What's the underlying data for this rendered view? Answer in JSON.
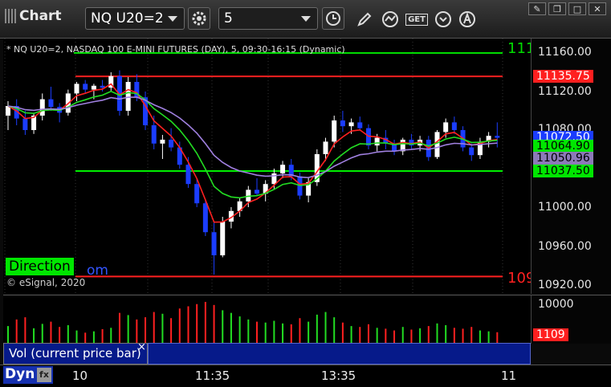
{
  "toolbar": {
    "title": "Chart",
    "symbol": "NQ U20=2",
    "interval": "5",
    "get_label": "GET"
  },
  "chart": {
    "description": "* NQ U20=2, NASDAQ 100 E-MINI FUTURES (DAY), 5, 09:30-16:15 (Dynamic)",
    "copyright": "© eSignal, 2020",
    "direction_label": "Direction",
    "partial_label": "om",
    "green_line_label": "111",
    "red_line_label": "109",
    "y_ticks": [
      "11160.00",
      "11120.00",
      "11080.00",
      "11000.00",
      "10960.00",
      "10920.00"
    ],
    "price_tags": [
      {
        "text": "11135.75",
        "bg": "#ff1f1f",
        "fg": "#ffffff",
        "price": 11135.75
      },
      {
        "text": "11072.50",
        "bg": "#1a3cff",
        "fg": "#ffffff",
        "price": 11072.5
      },
      {
        "text": "11064.90",
        "bg": "#00e600",
        "fg": "#000000",
        "price": 11064.9
      },
      {
        "text": "11050.96",
        "bg": "#8c7ab8",
        "fg": "#000000",
        "price": 11050.96
      },
      {
        "text": "11037.50",
        "bg": "#00e600",
        "fg": "#000000",
        "price": 11037.5
      }
    ],
    "levels": [
      {
        "price": 11160,
        "color": "#00dd00"
      },
      {
        "price": 11135.75,
        "color": "#ff2020"
      },
      {
        "price": 11037.5,
        "color": "#ff2020"
      },
      {
        "price": 11037.5,
        "color": "#00ee00"
      },
      {
        "price": 10928,
        "color": "#ff2020"
      }
    ],
    "colors": {
      "up": "#ffffff",
      "down": "#1b3dff",
      "ema_fast": "#ff2020",
      "ema_mid": "#22dd22",
      "ema_slow": "#a080e0"
    }
  },
  "volume": {
    "y_tick": "10000",
    "tag": "1109",
    "tag_bg": "#ff1f1f",
    "panel_label": "Vol (current price bar)",
    "close_glyph": "×"
  },
  "x_axis": {
    "labels": [
      "10",
      "11:35",
      "13:35",
      "11"
    ],
    "dyn_label": "Dyn"
  },
  "chart_data": {
    "type": "candlestick",
    "bars": [
      [
        11095,
        11110,
        11080,
        11105
      ],
      [
        11105,
        11112,
        11085,
        11092
      ],
      [
        11092,
        11100,
        11075,
        11080
      ],
      [
        11080,
        11098,
        11076,
        11095
      ],
      [
        11095,
        11118,
        11090,
        11112
      ],
      [
        11112,
        11125,
        11100,
        11104
      ],
      [
        11104,
        11108,
        11088,
        11098
      ],
      [
        11098,
        11122,
        11095,
        11118
      ],
      [
        11118,
        11130,
        11110,
        11128
      ],
      [
        11128,
        11132,
        11118,
        11122
      ],
      [
        11122,
        11128,
        11112,
        11126
      ],
      [
        11126,
        11132,
        11120,
        11124
      ],
      [
        11124,
        11140,
        11120,
        11136
      ],
      [
        11136,
        11142,
        11095,
        11100
      ],
      [
        11100,
        11135,
        11095,
        11130
      ],
      [
        11130,
        11138,
        11110,
        11114
      ],
      [
        11114,
        11120,
        11080,
        11085
      ],
      [
        11085,
        11095,
        11060,
        11066
      ],
      [
        11066,
        11075,
        11050,
        11070
      ],
      [
        11070,
        11082,
        11058,
        11062
      ],
      [
        11062,
        11068,
        11040,
        11044
      ],
      [
        11044,
        11052,
        11020,
        11024
      ],
      [
        11024,
        11030,
        11000,
        11004
      ],
      [
        11004,
        11008,
        10970,
        10974
      ],
      [
        10974,
        10985,
        10930,
        10950
      ],
      [
        10950,
        10990,
        10948,
        10985
      ],
      [
        10985,
        11000,
        10978,
        10996
      ],
      [
        10996,
        11010,
        10990,
        11006
      ],
      [
        11006,
        11022,
        11000,
        11018
      ],
      [
        11018,
        11030,
        11012,
        11014
      ],
      [
        11014,
        11028,
        11006,
        11024
      ],
      [
        11024,
        11040,
        11018,
        11035
      ],
      [
        11035,
        11048,
        11030,
        11044
      ],
      [
        11044,
        11050,
        11028,
        11032
      ],
      [
        11032,
        11036,
        11008,
        11012
      ],
      [
        11012,
        11030,
        11005,
        11026
      ],
      [
        11026,
        11060,
        11022,
        11055
      ],
      [
        11055,
        11072,
        11048,
        11068
      ],
      [
        11068,
        11095,
        11062,
        11090
      ],
      [
        11090,
        11100,
        11078,
        11084
      ],
      [
        11084,
        11092,
        11076,
        11088
      ],
      [
        11088,
        11094,
        11080,
        11082
      ],
      [
        11082,
        11086,
        11060,
        11064
      ],
      [
        11064,
        11076,
        11058,
        11072
      ],
      [
        11072,
        11080,
        11060,
        11066
      ],
      [
        11066,
        11070,
        11054,
        11058
      ],
      [
        11058,
        11072,
        11054,
        11070
      ],
      [
        11070,
        11076,
        11060,
        11064
      ],
      [
        11064,
        11074,
        11058,
        11070
      ],
      [
        11070,
        11074,
        11048,
        11052
      ],
      [
        11052,
        11080,
        11050,
        11078
      ],
      [
        11078,
        11092,
        11072,
        11088
      ],
      [
        11088,
        11094,
        11076,
        11080
      ],
      [
        11080,
        11084,
        11058,
        11062
      ],
      [
        11062,
        11066,
        11048,
        11054
      ],
      [
        11054,
        11072,
        11050,
        11068
      ],
      [
        11068,
        11078,
        11062,
        11074
      ],
      [
        11074,
        11088,
        11062,
        11072
      ]
    ],
    "volume": [
      40,
      55,
      60,
      35,
      45,
      50,
      38,
      42,
      30,
      25,
      28,
      33,
      36,
      70,
      65,
      55,
      60,
      72,
      68,
      58,
      80,
      85,
      90,
      95,
      88,
      76,
      70,
      62,
      55,
      50,
      48,
      52,
      46,
      44,
      58,
      50,
      66,
      72,
      60,
      48,
      40,
      38,
      44,
      36,
      34,
      30,
      38,
      32,
      35,
      40,
      46,
      42,
      36,
      34,
      38,
      30,
      28,
      26
    ]
  }
}
